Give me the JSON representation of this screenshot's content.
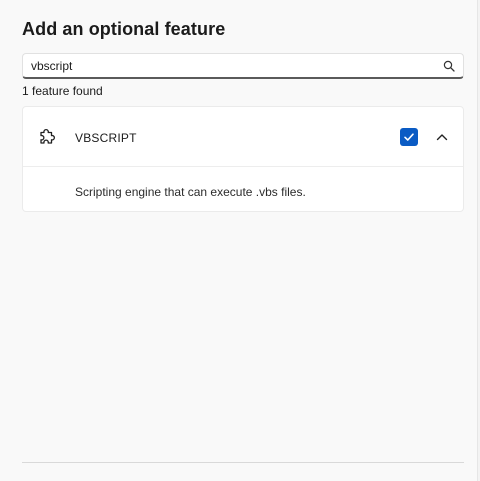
{
  "dialog": {
    "title": "Add an optional feature"
  },
  "search": {
    "value": "vbscript",
    "icon": "search-icon"
  },
  "results": {
    "count_label": "1 feature found"
  },
  "feature": {
    "name": "VBSCRIPT",
    "description": "Scripting engine that can execute .vbs files.",
    "icon": "puzzle-icon",
    "checked": true,
    "expanded": true
  },
  "colors": {
    "accent": "#0a5bc4",
    "background": "#f9f9f9",
    "card": "#ffffff"
  }
}
